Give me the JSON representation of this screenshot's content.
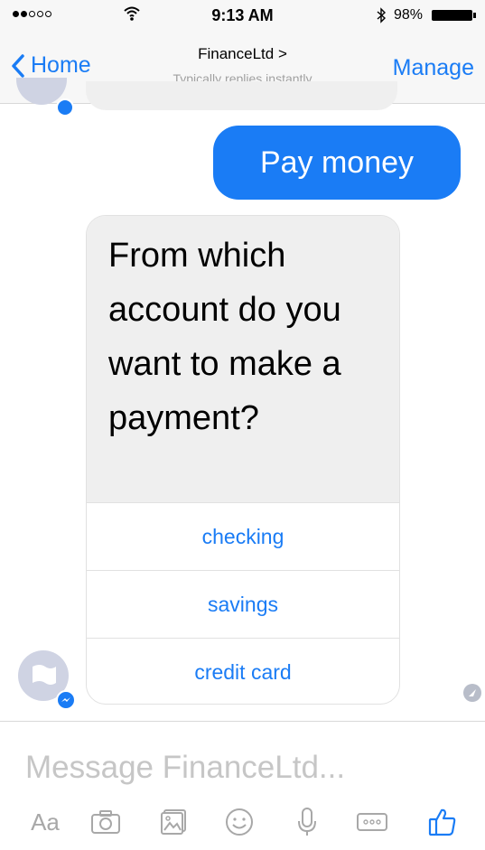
{
  "status_bar": {
    "time": "9:13 AM",
    "battery": "98%"
  },
  "nav": {
    "back_label": "Home",
    "title": "FinanceLtd >",
    "subtitle": "Typically replies instantly",
    "manage_label": "Manage"
  },
  "chat": {
    "sent_message": "Pay money",
    "question": "From which account do you want to make a payment?",
    "options": [
      "checking",
      "savings",
      "credit card"
    ]
  },
  "composer": {
    "placeholder": "Message FinanceLtd...",
    "aa_label": "Aa"
  },
  "colors": {
    "accent": "#1a7cf5",
    "bubble_gray": "#efefef"
  },
  "icons": [
    "signal-dots-icon",
    "wifi-icon",
    "bluetooth-icon",
    "battery-icon",
    "chevron-left-icon",
    "camera-icon",
    "photo-icon",
    "emoji-icon",
    "microphone-icon",
    "more-icon",
    "thumbs-up-icon"
  ]
}
